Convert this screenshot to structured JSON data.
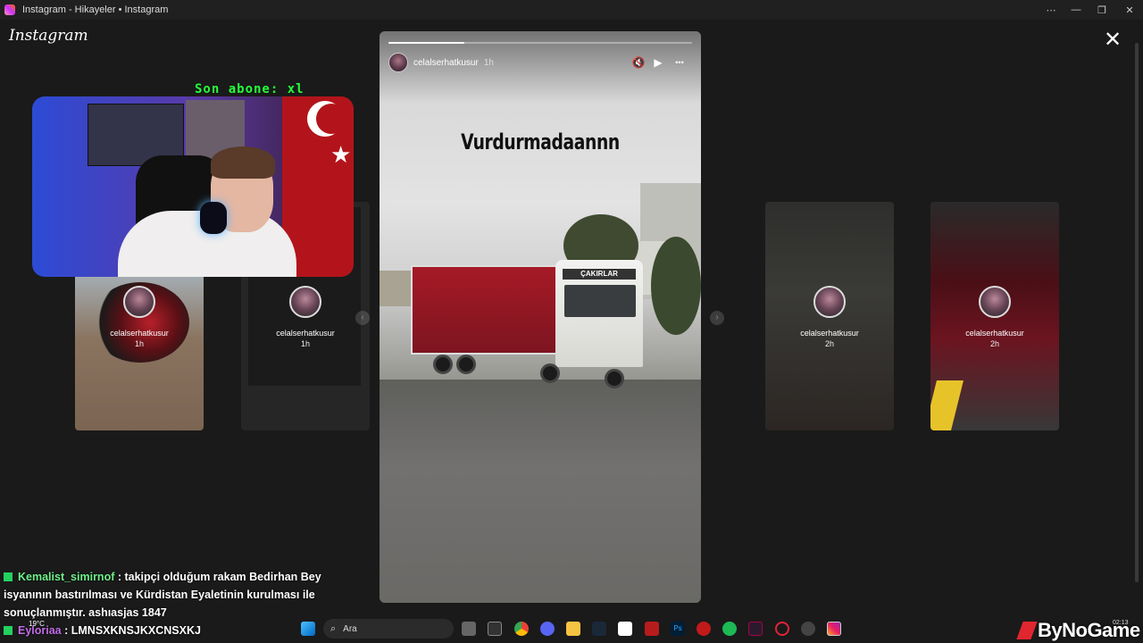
{
  "window": {
    "title": "Instagram - Hikayeler • Instagram",
    "controls": [
      "⋯",
      "—",
      "❐",
      "✕"
    ]
  },
  "app": {
    "logo": "Instagram",
    "close_icon": "✕"
  },
  "story": {
    "username": "celalserhatkusur",
    "time": "1h",
    "caption": "Vurdurmadaannn",
    "progress": 0.25,
    "truck_sign": "ÇAKIRLAR",
    "controls": {
      "mute": "🔇",
      "play": "▶",
      "more": "•••"
    }
  },
  "side_stories": [
    {
      "username": "celalserhatkusur",
      "time": "1h"
    },
    {
      "username": "celalserhatkusur",
      "time": "1h"
    },
    {
      "username": "celalserhatkusur",
      "time": "2h"
    },
    {
      "username": "celalserhatkusur",
      "time": "2h"
    }
  ],
  "nav": {
    "prev": "‹",
    "next": "›"
  },
  "overlay": {
    "sub_banner": "Son abone: xl"
  },
  "chat": [
    {
      "user": "Kemalist_simirnof",
      "message": ": takipçi olduğum rakam Bedirhan Bey isyanının bastırılması ve Kürdistan Eyaletinin kurulması ile sonuçlanmıştır. ashıasjas 1847"
    },
    {
      "user": "Eyloriaa",
      "message": ": LMNSXKNSJKXCNSXKJ"
    }
  ],
  "taskbar": {
    "weather": "19°C",
    "search_placeholder": "Ara",
    "brand": "ByNoGame",
    "clock": "02:13"
  },
  "colors": {
    "background": "#1a1a1a",
    "sub_banner": "#25ff3a",
    "chat_user1": "#6ef08a",
    "chat_user2": "#c26be6",
    "brand_mark": "#e0262f"
  }
}
